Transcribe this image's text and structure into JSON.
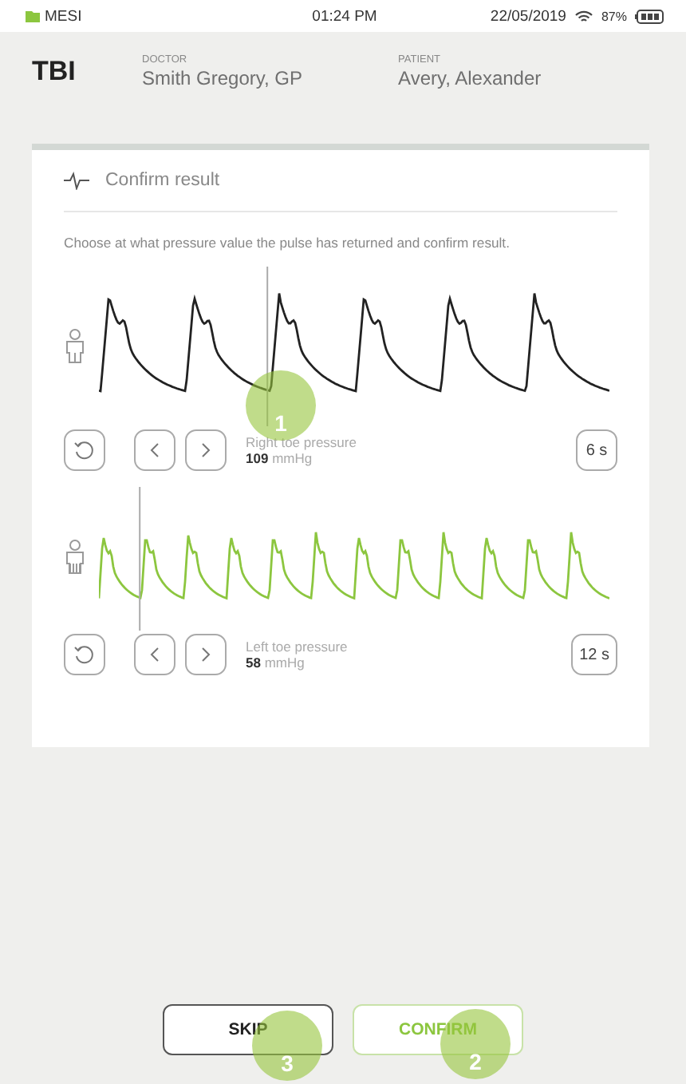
{
  "status_bar": {
    "carrier": "MESI",
    "time": "01:24 PM",
    "date": "22/05/2019",
    "battery": "87%"
  },
  "header": {
    "title": "TBI",
    "fields": [
      {
        "label": "DOCTOR",
        "value": "Smith Gregory, GP"
      },
      {
        "label": "PATIENT",
        "value": "Avery, Alexander"
      }
    ]
  },
  "card": {
    "title": "Confirm result",
    "instruction": "Choose at what pressure value the pulse has returned and confirm result.",
    "channels": [
      {
        "label": "Right toe pressure",
        "value": "109",
        "unit": "mmHg",
        "duration": "6 s",
        "color": "#222222"
      },
      {
        "label": "Left toe pressure",
        "value": "58",
        "unit": "mmHg",
        "duration": "12 s",
        "color": "#8cc63f"
      }
    ]
  },
  "buttons": [
    {
      "label": "SKIP",
      "kind": "secondary"
    },
    {
      "label": "CONFIRM",
      "kind": "primary"
    }
  ],
  "callouts": [
    {
      "number": "1"
    },
    {
      "number": "3"
    },
    {
      "number": "2"
    }
  ]
}
